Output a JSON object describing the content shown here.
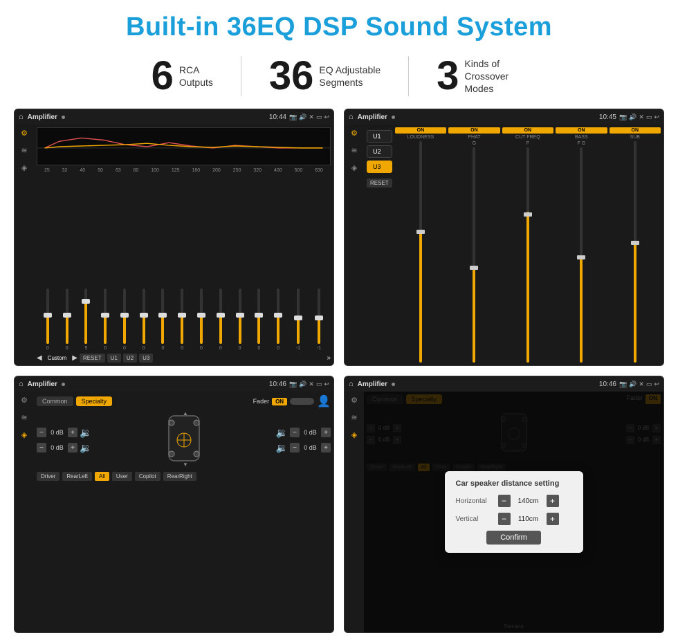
{
  "page": {
    "title": "Built-in 36EQ DSP Sound System",
    "background": "#ffffff"
  },
  "stats": [
    {
      "number": "6",
      "label_line1": "RCA",
      "label_line2": "Outputs"
    },
    {
      "number": "36",
      "label_line1": "EQ Adjustable",
      "label_line2": "Segments"
    },
    {
      "number": "3",
      "label_line1": "Kinds of",
      "label_line2": "Crossover Modes"
    }
  ],
  "screen1": {
    "title": "Amplifier",
    "time": "10:44",
    "type": "EQ",
    "freq_labels": [
      "25",
      "32",
      "40",
      "50",
      "63",
      "80",
      "100",
      "125",
      "160",
      "200",
      "250",
      "320",
      "400",
      "500",
      "630"
    ],
    "sliders": [
      0,
      0,
      5,
      0,
      0,
      0,
      0,
      0,
      0,
      0,
      0,
      0,
      0,
      -1,
      -1
    ],
    "bottom_buttons": [
      "Custom",
      "RESET",
      "U1",
      "U2",
      "U3"
    ]
  },
  "screen2": {
    "title": "Amplifier",
    "time": "10:45",
    "type": "Crossover",
    "u_buttons": [
      "U1",
      "U2",
      "U3"
    ],
    "active_u": "U3",
    "channels": [
      {
        "name": "LOUDNESS",
        "on": true
      },
      {
        "name": "PHAT",
        "on": true
      },
      {
        "name": "CUT FREQ",
        "on": true
      },
      {
        "name": "BASS",
        "on": true
      },
      {
        "name": "SUB",
        "on": true
      }
    ],
    "reset_label": "RESET"
  },
  "screen3": {
    "title": "Amplifier",
    "time": "10:46",
    "type": "Fader",
    "tabs": [
      "Common",
      "Specialty"
    ],
    "active_tab": "Specialty",
    "fader_label": "Fader",
    "fader_on": "ON",
    "channels": [
      {
        "label": "0 dB"
      },
      {
        "label": "0 dB"
      },
      {
        "label": "0 dB"
      },
      {
        "label": "0 dB"
      }
    ],
    "bottom_buttons": [
      "Driver",
      "RearLeft",
      "All",
      "User",
      "Copilot",
      "RearRight"
    ],
    "active_bottom": "All"
  },
  "screen4": {
    "title": "Amplifier",
    "time": "10:46",
    "type": "Distance",
    "dialog": {
      "title": "Car speaker distance setting",
      "horizontal_label": "Horizontal",
      "horizontal_value": "140cm",
      "vertical_label": "Vertical",
      "vertical_value": "110cm",
      "confirm_label": "Confirm"
    }
  },
  "watermark": "Seicane"
}
